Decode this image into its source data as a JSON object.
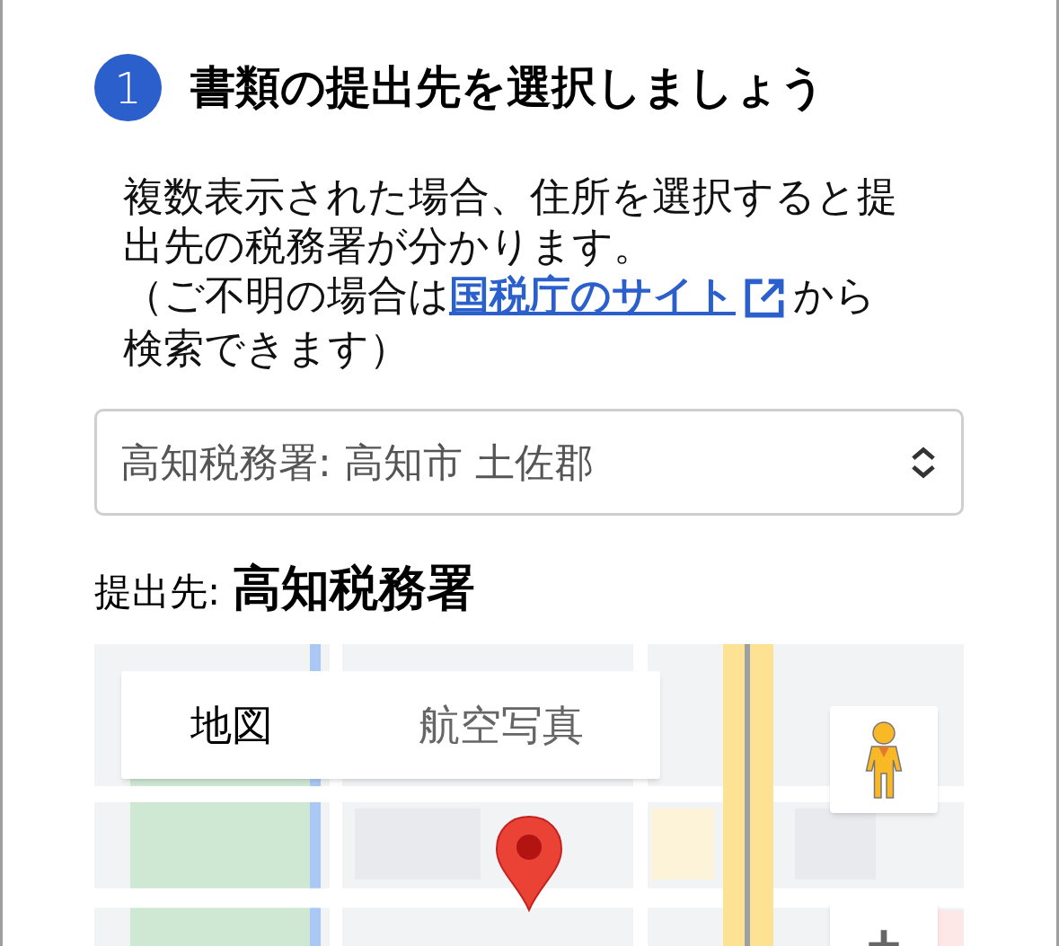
{
  "step": {
    "number": "1",
    "title": "書類の提出先を選択しましょう"
  },
  "description": {
    "intro": "複数表示された場合、住所を選択すると提出先の税務署が分かります。",
    "note_before": "（ご不明の場合は",
    "link": "国税庁のサイト",
    "note_after": "から検索できます）"
  },
  "office_select": {
    "value": "高知税務署: 高知市 土佐郡"
  },
  "destination": {
    "label": "提出先:",
    "value": "高知税務署"
  },
  "map": {
    "type_tabs": [
      {
        "label": "地図",
        "selected": true
      },
      {
        "label": "航空写真",
        "selected": false
      }
    ]
  }
}
